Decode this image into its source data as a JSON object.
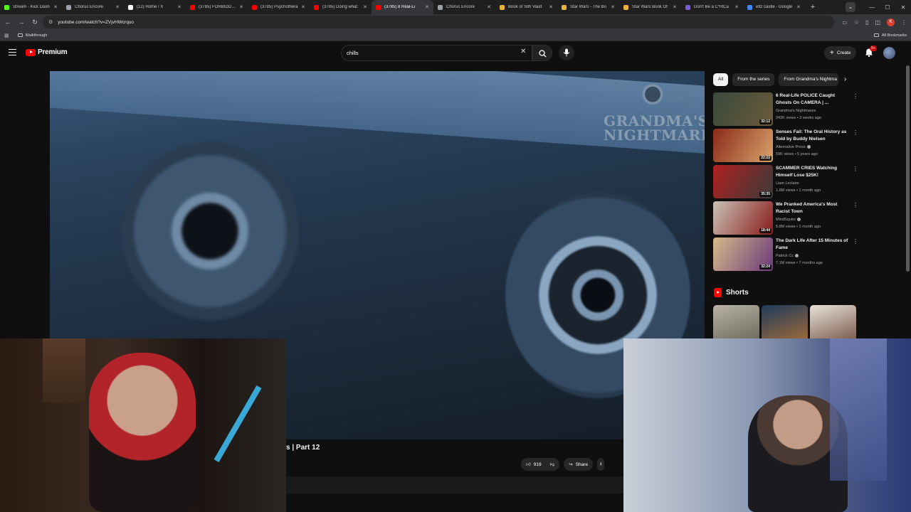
{
  "browser": {
    "tabs": [
      {
        "title": "Stream - Kick Dash",
        "favicon_color": "#53fc18",
        "active": false
      },
      {
        "title": "Chorus Encore",
        "favicon_color": "#9aa0a6",
        "active": false
      },
      {
        "title": "(12) Home / X",
        "favicon_color": "#ffffff",
        "active": false
      },
      {
        "title": "(3785) FORBIDDEN",
        "favicon_color": "#ff0000",
        "active": false
      },
      {
        "title": "(3785) Psychothera",
        "favicon_color": "#ff0000",
        "active": false
      },
      {
        "title": "(3785) Doing what",
        "favicon_color": "#ff0000",
        "active": false
      },
      {
        "title": "(3785) 8 Real-Li",
        "favicon_color": "#ff0000",
        "active": true
      },
      {
        "title": "Chorus Encore",
        "favicon_color": "#9aa0a6",
        "active": false
      },
      {
        "title": "Book of Sith Vault",
        "favicon_color": "#e8b339",
        "active": false
      },
      {
        "title": "Star Wars - The Bo",
        "favicon_color": "#e8b339",
        "active": false
      },
      {
        "title": "Star Wars Book Of",
        "favicon_color": "#e8b339",
        "active": false
      },
      {
        "title": "Don't Be a C*ntCa",
        "favicon_color": "#7b5cd6",
        "active": false
      },
      {
        "title": "eltz castle - Google",
        "favicon_color": "#4285f4",
        "active": false
      }
    ],
    "url": "youtube.com/watch?v=ZVjvHWcrquo",
    "profile_initial": "K",
    "bookmarks": {
      "folder": "Walkthrough",
      "all_bookmarks": "All Bookmarks"
    }
  },
  "youtube": {
    "logo_text": "Premium",
    "search_value": "chills",
    "create_label": "Create",
    "notification_count": "9+",
    "video": {
      "watermark": "GRANDMA'S NIGHTMARES",
      "title_fragment": "s | Part 12",
      "likes": "919",
      "share_label": "Share"
    },
    "chips": [
      "All",
      "From the series",
      "From Grandma's Nightma"
    ],
    "recommendations": [
      {
        "title": "6 Real-Life POLICE Caught Ghosts On CAMERA | ...",
        "channel": "Grandma's Nightmares",
        "meta": "242K views • 3 weeks ago",
        "duration": "32:12",
        "verified": false,
        "thumb_colors": [
          "#3a4a3c",
          "#6b5a3a"
        ]
      },
      {
        "title": "Senses Fail: The Oral History as Told by Buddy Nielsen",
        "channel": "Alternative Press",
        "meta": "59K views • 5 years ago",
        "duration": "22:22",
        "verified": true,
        "thumb_colors": [
          "#8a2a1a",
          "#d9a36a"
        ]
      },
      {
        "title": "SCAMMER CRIES Watching Himself Lose $25K!",
        "channel": "Liam Leclaire",
        "meta": "1.8M views • 1 month ago",
        "duration": "35:35",
        "verified": false,
        "thumb_colors": [
          "#b02020",
          "#3a3a3a"
        ]
      },
      {
        "title": "We Pranked America's Most Racist Town",
        "channel": "MindSquire",
        "meta": "5.8M views • 1 month ago",
        "duration": "18:44",
        "verified": true,
        "thumb_colors": [
          "#c9c2b5",
          "#8a1b1b"
        ]
      },
      {
        "title": "The Dark Life After 15 Minutes of Fame",
        "channel": "Patrick Cc",
        "meta": "7.1M views • 7 months ago",
        "duration": "32:24",
        "verified": true,
        "thumb_colors": [
          "#d7b98a",
          "#6a3a7a"
        ]
      }
    ],
    "shorts_label": "Shorts",
    "shorts_thumbs": [
      {
        "colors": [
          "#b8b3a6",
          "#6a6a5c"
        ]
      },
      {
        "colors": [
          "#1d3a5a",
          "#a06a3a"
        ]
      },
      {
        "colors": [
          "#e8e2da",
          "#7a5a4a"
        ]
      }
    ]
  }
}
